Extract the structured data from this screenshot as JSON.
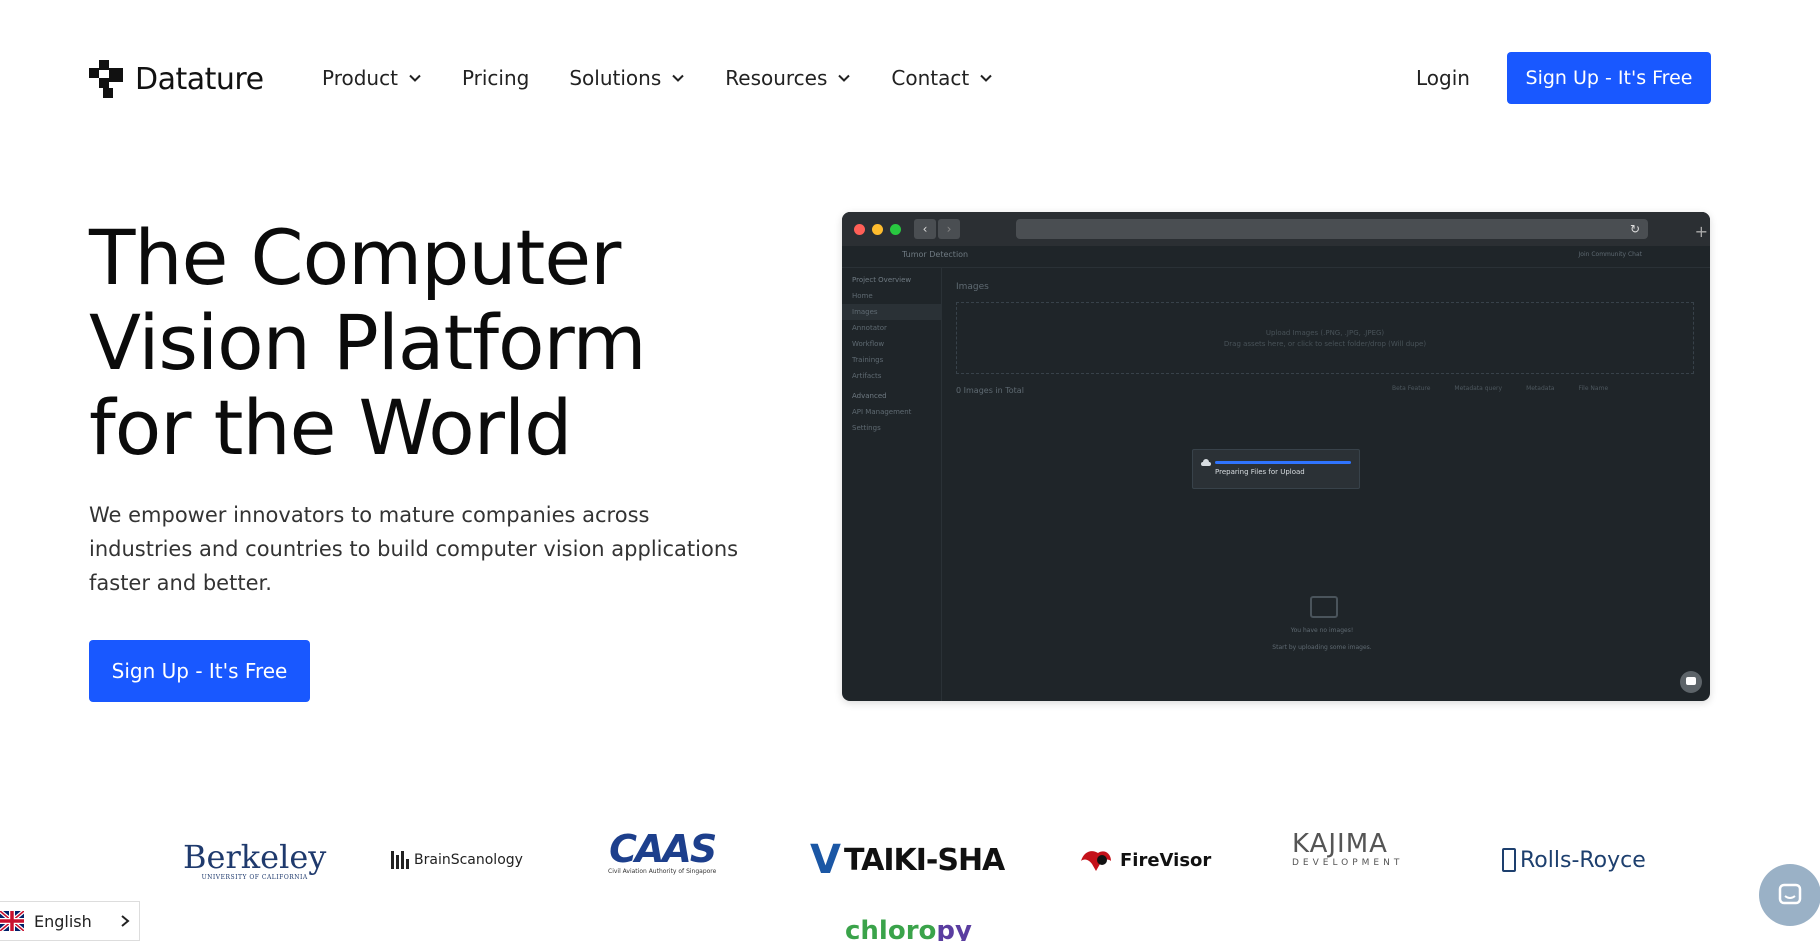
{
  "brand": {
    "name": "Datature"
  },
  "nav": {
    "items": [
      {
        "label": "Product",
        "has_dropdown": true
      },
      {
        "label": "Pricing",
        "has_dropdown": false
      },
      {
        "label": "Solutions",
        "has_dropdown": true
      },
      {
        "label": "Resources",
        "has_dropdown": true
      },
      {
        "label": "Contact",
        "has_dropdown": true
      }
    ],
    "login_label": "Login",
    "signup_label": "Sign Up - It's Free"
  },
  "hero": {
    "title": "The Computer Vision Platform for the World",
    "subtitle": "We empower innovators to mature companies across industries and countries to build computer vision applications faster and better.",
    "cta_label": "Sign Up - It's Free"
  },
  "preview": {
    "breadcrumb": "Tumor Detection",
    "community": "Join Community Chat",
    "sidebar": {
      "project_heading": "Project Overview",
      "project_items": [
        "Home",
        "Images",
        "Annotator",
        "Workflow",
        "Trainings",
        "Artifacts"
      ],
      "advanced_heading": "Advanced",
      "advanced_items": [
        "API Management",
        "Settings"
      ]
    },
    "images_heading": "Images",
    "upload_title": "Upload Images (.PNG, .JPG, .JPEG)",
    "upload_hint": "Drag assets here, or click to select folder/drop (Will dupe)",
    "total_label": "0 Images in Total",
    "filters": [
      "Beta Feature",
      "Metadata query",
      "Metadata",
      "File Name"
    ],
    "toast_text": "Preparing Files for Upload",
    "empty_title": "You have no images!",
    "empty_hint": "Start by uploading some images."
  },
  "logos": [
    {
      "name": "Berkeley",
      "sub": "UNIVERSITY OF CALIFORNIA"
    },
    {
      "name": "BrainScanology"
    },
    {
      "name": "CAAS",
      "sub": "Civil Aviation Authority of Singapore"
    },
    {
      "name": "TAIKI-SHA"
    },
    {
      "name": "FireVisor"
    },
    {
      "name": "KAJIMA",
      "sub": "DEVELOPMENT"
    },
    {
      "name": "Rolls-Royce"
    },
    {
      "name": "chloro",
      "suffix": "py"
    }
  ],
  "language": {
    "label": "English"
  },
  "colors": {
    "accent": "#1958ff",
    "preview_bg": "#1f2529"
  }
}
